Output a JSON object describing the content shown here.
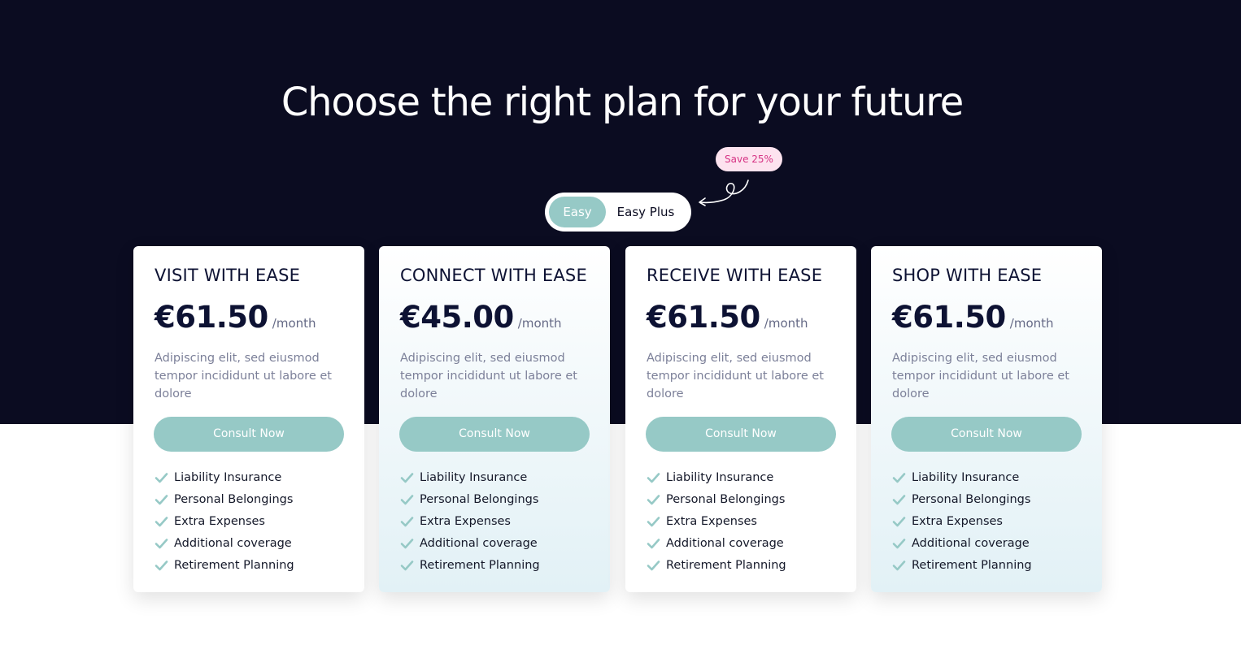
{
  "colors": {
    "hero_bg": "#0b0c21",
    "accent": "#96c9c6",
    "badge_bg": "#fde3ef",
    "badge_text": "#d63384",
    "title_text": "#0d1233"
  },
  "hero": {
    "heading": "Choose the right plan for your future",
    "save_badge": "Save 25%",
    "toggle": {
      "options": [
        "Easy",
        "Easy Plus"
      ],
      "selected": "Easy"
    }
  },
  "plans": [
    {
      "title": "VISIT WITH EASE",
      "price": "€61.50",
      "period": "/month",
      "description": "Adipiscing elit, sed eiusmod tempor incididunt ut labore et dolore",
      "cta": "Consult Now",
      "features": [
        "Liability Insurance",
        "Personal Belongings",
        "Extra Expenses",
        "Additional coverage",
        "Retirement Planning"
      ]
    },
    {
      "title": "CONNECT WITH EASE",
      "price": "€45.00",
      "period": "/month",
      "description": "Adipiscing elit, sed eiusmod tempor incididunt ut labore et dolore",
      "cta": "Consult Now",
      "features": [
        "Liability Insurance",
        "Personal Belongings",
        "Extra Expenses",
        "Additional coverage",
        "Retirement Planning"
      ]
    },
    {
      "title": "RECEIVE WITH EASE",
      "price": "€61.50",
      "period": "/month",
      "description": "Adipiscing elit, sed eiusmod tempor incididunt ut labore et dolore",
      "cta": "Consult Now",
      "features": [
        "Liability Insurance",
        "Personal Belongings",
        "Extra Expenses",
        "Additional coverage",
        "Retirement Planning"
      ]
    },
    {
      "title": "SHOP WITH EASE",
      "price": "€61.50",
      "period": "/month",
      "description": "Adipiscing elit, sed eiusmod tempor incididunt ut labore et dolore",
      "cta": "Consult Now",
      "features": [
        "Liability Insurance",
        "Personal Belongings",
        "Extra Expenses",
        "Additional coverage",
        "Retirement Planning"
      ]
    }
  ],
  "icons": {
    "feature": "check-icon",
    "badge_pointer": "curly-arrow-icon"
  }
}
